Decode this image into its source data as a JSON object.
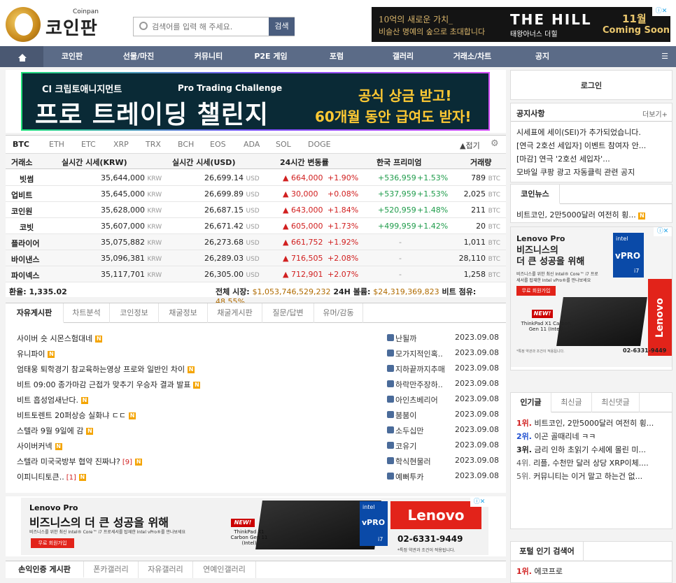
{
  "site": {
    "logo_sub": "Coinpan",
    "logo_main": "코인판"
  },
  "search": {
    "placeholder": "검색어를 입력 해 주세요.",
    "button": "검색"
  },
  "top_ad": {
    "line1": "10억의 새로운 가치_",
    "line2": "비슬산 명예의 숲으로 초대합니다",
    "brand": "THE HILL",
    "brand_sub": "태왕아너스 더힐",
    "month": "11월",
    "coming": "Coming Soon",
    "ad_mark": "ⓘ✕"
  },
  "nav": {
    "items": [
      "코인판",
      "선물/마진",
      "커뮤니티",
      "P2E 게임",
      "포럼",
      "갤러리",
      "거래소/차트",
      "공지"
    ],
    "menu_icon": "☰"
  },
  "banner": {
    "brand": "Cl 크립토애니지먼트",
    "tagline": "Pro Trading Challenge",
    "headline": "프로 트레이딩 챌린지",
    "right1": "공식 상금 받고!",
    "right2": "60개월 동안 급여도 받자!"
  },
  "coin_tabs": [
    "BTC",
    "ETH",
    "ETC",
    "XRP",
    "TRX",
    "BCH",
    "EOS",
    "ADA",
    "SOL",
    "DOGE"
  ],
  "market": {
    "fold": "▲접기",
    "gear_icon": "⚙",
    "headers": [
      "거래소",
      "실시간 시세(KRW)",
      "실시간 시세(USD)",
      "24시간 변동률",
      "한국 프리미엄",
      "거래량"
    ],
    "unit_krw": "KRW",
    "unit_usd": "USD",
    "unit_btc": "BTC",
    "rows": [
      {
        "ex": "빗썸",
        "krw": "35,644,000",
        "usd": "26,699.14",
        "chg": "▲ 664,000",
        "pct": "+1.90%",
        "prem": "+536,959",
        "prem_pct": "+1.53%",
        "vol": "789"
      },
      {
        "ex": "업비트",
        "krw": "35,645,000",
        "usd": "26,699.89",
        "chg": "▲ 30,000",
        "pct": "+0.08%",
        "prem": "+537,959",
        "prem_pct": "+1.53%",
        "vol": "2,025"
      },
      {
        "ex": "코인원",
        "krw": "35,628,000",
        "usd": "26,687.15",
        "chg": "▲ 643,000",
        "pct": "+1.84%",
        "prem": "+520,959",
        "prem_pct": "+1.48%",
        "vol": "211"
      },
      {
        "ex": "코빗",
        "krw": "35,607,000",
        "usd": "26,671.42",
        "chg": "▲ 605,000",
        "pct": "+1.73%",
        "prem": "+499,959",
        "prem_pct": "+1.42%",
        "vol": "20"
      },
      {
        "ex": "플라이어",
        "krw": "35,075,882",
        "usd": "26,273.68",
        "chg": "▲ 661,752",
        "pct": "+1.92%",
        "prem": "-",
        "prem_pct": "",
        "vol": "1,011"
      },
      {
        "ex": "바이낸스",
        "krw": "35,096,381",
        "usd": "26,289.03",
        "chg": "▲ 716,505",
        "pct": "+2.08%",
        "prem": "-",
        "prem_pct": "",
        "vol": "28,110"
      },
      {
        "ex": "파이넥스",
        "krw": "35,117,701",
        "usd": "26,305.00",
        "chg": "▲ 712,901",
        "pct": "+2.07%",
        "prem": "-",
        "prem_pct": "",
        "vol": "1,258"
      }
    ],
    "fx_label": "환율: 1,335.02",
    "total_label": "전체 시장:",
    "total_value": "$1,053,746,529,232",
    "vol_label": "24H 볼륨:",
    "vol_value": "$24,319,369,823",
    "dom_label": "비트 점유:",
    "dom_value": "48.55%"
  },
  "board": {
    "tabs": [
      "자유게시판",
      "차트분석",
      "코인정보",
      "채굴정보",
      "채굴게시판",
      "질문/답변",
      "유머/감동"
    ],
    "posts": [
      {
        "title": "사이버 숏 시몬스험대네",
        "cc": "",
        "user": "난될까",
        "date": "2023.09.08"
      },
      {
        "title": "유니파이",
        "cc": "",
        "user": "모가지적인혹..",
        "date": "2023.09.08"
      },
      {
        "title": "엄태웅 퇴학경기 참교육하는영상 프로와 일반인 차이",
        "cc": "",
        "user": "지하끝까지추매",
        "date": "2023.09.08"
      },
      {
        "title": "비트 09:00 종가마감 근접가 맞추기 우승자 결과 발표",
        "cc": "",
        "user": "하락만주장하..",
        "date": "2023.09.08"
      },
      {
        "title": "비트 흡성엄새난다.",
        "cc": "",
        "user": "아인츠베리어",
        "date": "2023.09.08"
      },
      {
        "title": "비트토렌트 20퍼상승 실화냐 ㄷㄷ",
        "cc": "",
        "user": "붐붐이",
        "date": "2023.09.08"
      },
      {
        "title": "스텔라 9월 9일에 감",
        "cc": "",
        "user": "소두십만",
        "date": "2023.09.08"
      },
      {
        "title": "사이버커넥",
        "cc": "",
        "user": "코유기",
        "date": "2023.09.08"
      },
      {
        "title": "스텔라 미국국방부 협약 진짜냐?",
        "cc": "[9]",
        "user": "학식현물러",
        "date": "2023.09.08"
      },
      {
        "title": "이피니티토큰..",
        "cc": "[1]",
        "user": "예뻐투카",
        "date": "2023.09.08"
      }
    ],
    "new_badge": "N"
  },
  "ad_bottom": {
    "brand": "Lenovo Pro",
    "headline": "비즈니스의 더 큰 성공을 위해",
    "sub": "비즈니스를 위한 최신 Intel® Core™ i7 프로세서를 탑재한 Intel vPro®를 만나보세요",
    "btn": "무료 회원가입",
    "new": "NEW!",
    "model": "ThinkPad X1 Carbon Gen 11 (Intel)",
    "vpro": "vPRO",
    "intel": "intel",
    "i7": "i7",
    "lenovo": "Lenovo",
    "phone": "02-6331-9449",
    "note": "*특정 약관과 조건이 적용됩니다.",
    "ad_mark": "ⓘ✕"
  },
  "bottom_tabs": [
    "손익인증 게시판",
    "폰카갤러리",
    "자유갤러리",
    "연예인갤러리"
  ],
  "side": {
    "login": "로그인",
    "notice_title": "공지사항",
    "notice_more": "더보기+",
    "notices": [
      "시세표에 세이(SEI)가 추가되었습니다.",
      "[연극 2호선 세입자] 이벤트 참여자 안...",
      "[마감] 연극 '2호선 세입자'...",
      "모바일 쿠팡 광고 자동클릭 관련 공지"
    ],
    "news_title": "코인뉴스",
    "news": [
      "비트코인, 2만5000달러 여전히 횡..."
    ],
    "ad": {
      "brand": "Lenovo Pro",
      "headline1": "비즈니스의",
      "headline2": "더 큰 성공을 위해",
      "sub": "비즈니스를 위한 최신 Intel® Core™ i7 프로세서를 탑재한 Intel vPro®를 만나보세요",
      "btn": "무료 회원가입",
      "new": "NEW!",
      "model": "ThinkPad X1 Carbon Gen 11 (Intel)",
      "vpro": "vPRO",
      "intel": "intel",
      "i7": "i7",
      "lenovo": "Lenovo",
      "phone": "02-6331-9449",
      "note": "*특정 약관과 조건이 적용됩니다.",
      "ad_mark": "ⓘ✕"
    },
    "pop_tabs": [
      "인기글",
      "최신글",
      "최신댓글"
    ],
    "popular": [
      {
        "rank": "1위.",
        "text": "비트코인, 2만5000달러 여전히 횡..."
      },
      {
        "rank": "2위.",
        "text": "이곤 골때리네 ㅋㅋ"
      },
      {
        "rank": "3위.",
        "text": "금리 인하 초읽기 수세에 몰린 미..."
      },
      {
        "rank": "4위.",
        "text": "리플, 수천만 달러 상당 XRP이체...."
      },
      {
        "rank": "5위.",
        "text": "커뮤니티는 이거 말고 하는건 없..."
      }
    ],
    "portal_title": "포털 인기 검색어",
    "portal": [
      {
        "rank": "1위.",
        "text": "에코프로"
      }
    ]
  }
}
